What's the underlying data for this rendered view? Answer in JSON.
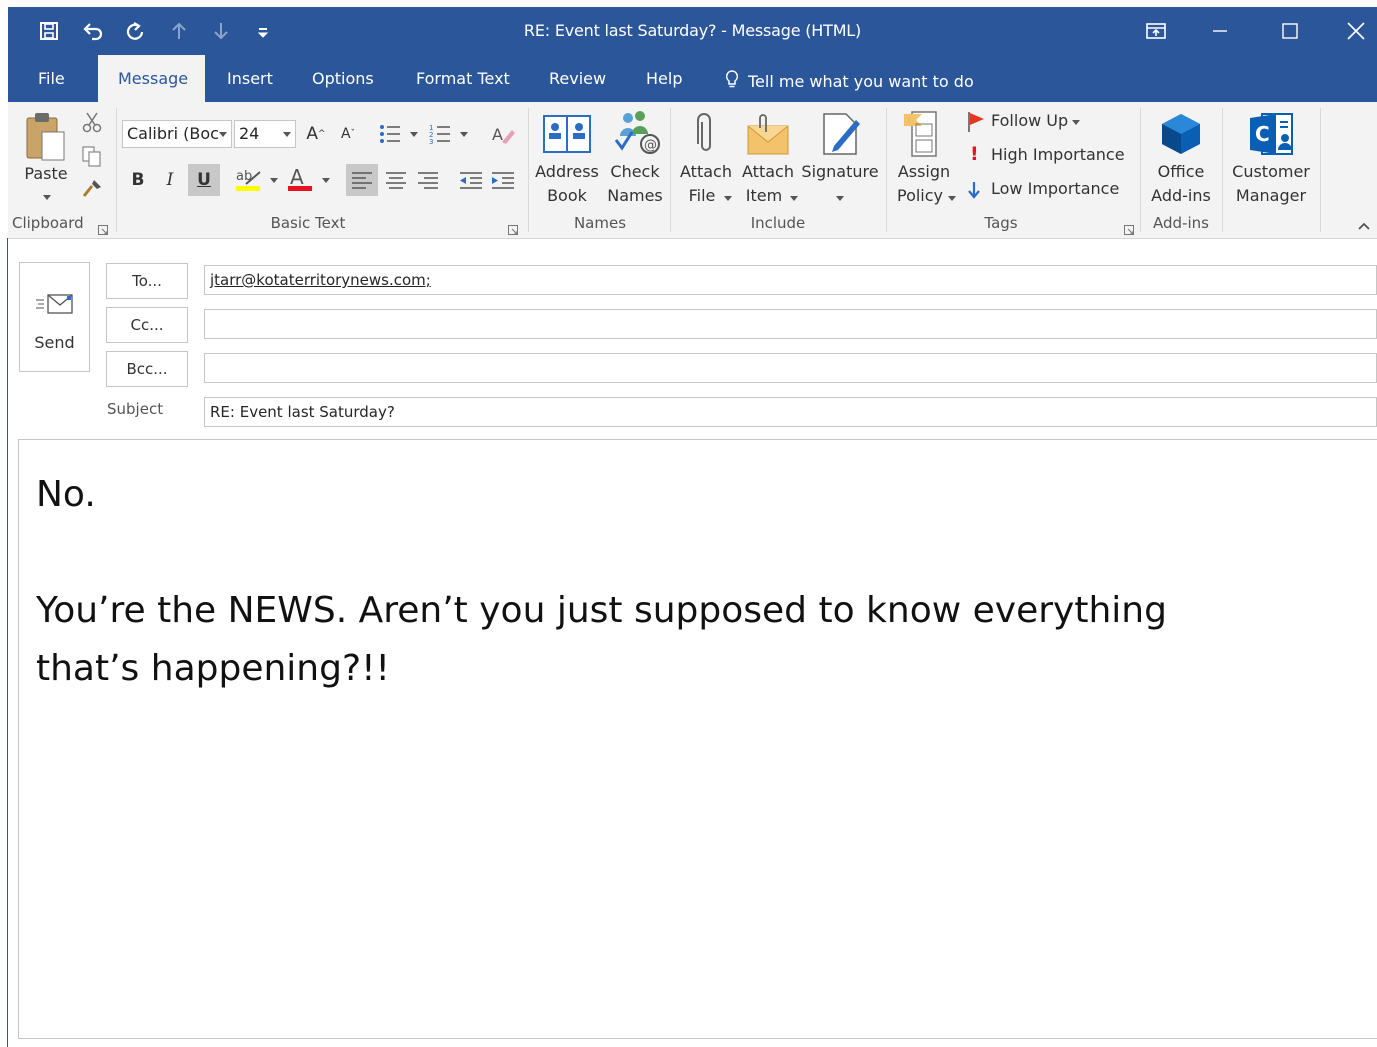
{
  "window": {
    "title": "RE: Event last Saturday?  -  Message (HTML)"
  },
  "tabs": [
    {
      "label": "File"
    },
    {
      "label": "Message"
    },
    {
      "label": "Insert"
    },
    {
      "label": "Options"
    },
    {
      "label": "Format Text"
    },
    {
      "label": "Review"
    },
    {
      "label": "Help"
    }
  ],
  "tell_me": "Tell me what you want to do",
  "ribbon": {
    "clipboard": {
      "paste": "Paste",
      "group": "Clipboard"
    },
    "basic_text": {
      "font_name": "Calibri (Boc",
      "font_size": "24",
      "bold": "B",
      "italic": "I",
      "underline": "U",
      "group": "Basic Text"
    },
    "names": {
      "address_book_1": "Address",
      "address_book_2": "Book",
      "check_names_1": "Check",
      "check_names_2": "Names",
      "group": "Names"
    },
    "include": {
      "attach_file_1": "Attach",
      "attach_file_2": "File",
      "attach_item_1": "Attach",
      "attach_item_2": "Item",
      "signature": "Signature",
      "group": "Include"
    },
    "tags": {
      "assign_policy_1": "Assign",
      "assign_policy_2": "Policy",
      "follow_up": "Follow Up",
      "high_importance": "High Importance",
      "low_importance": "Low Importance",
      "group": "Tags"
    },
    "addins": {
      "office_1": "Office",
      "office_2": "Add-ins",
      "group": "Add-ins"
    },
    "customer_manager": {
      "line1": "Customer",
      "line2": "Manager"
    }
  },
  "compose": {
    "send": "Send",
    "to_label": "To...",
    "cc_label": "Cc...",
    "bcc_label": "Bcc...",
    "subject_label": "Subject",
    "to_value": "jtarr@kotaterritorynews.com;",
    "cc_value": "",
    "bcc_value": "",
    "subject_value": "RE: Event last Saturday?"
  },
  "body": {
    "line1": "No.",
    "line2": "You’re the NEWS. Aren’t you just supposed to know everything",
    "line3": "that’s happening?!!"
  },
  "colors": {
    "accent": "#2b579a",
    "ribbon_bg": "#f3f3f3",
    "highlight": "#ffff00",
    "font_color": "#e81123",
    "flag": "#e03a1e",
    "importance_high": "#e81123",
    "importance_low": "#2b6cc4",
    "office_addin": "#0a5fb4"
  }
}
